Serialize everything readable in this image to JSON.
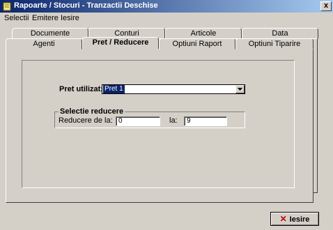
{
  "window": {
    "title": "Rapoarte / Stocuri - Tranzactii Deschise",
    "close_label": "x"
  },
  "menu": [
    "Selectii",
    "Emitere",
    "Iesire"
  ],
  "tabs_back": [
    "Documente",
    "Conturi",
    "Articole",
    "Data"
  ],
  "tabs_front": [
    "Agenti",
    "Pret / Reducere",
    "Optiuni Raport",
    "Optiuni Tiparire"
  ],
  "active_tab": "Pret / Reducere",
  "pret": {
    "label": "Pret utilizat:",
    "value": "Pret 1"
  },
  "reducere": {
    "group_title": "Selectie reducere",
    "from_label": "Reducere de la:",
    "from_value": "0",
    "to_label": "la:",
    "to_value": "9"
  },
  "exit_button": {
    "label": "Iesire",
    "icon": "x-icon"
  },
  "colors": {
    "title_start": "#0a246a",
    "title_end": "#a6caf0",
    "face": "#d4d0c8"
  }
}
